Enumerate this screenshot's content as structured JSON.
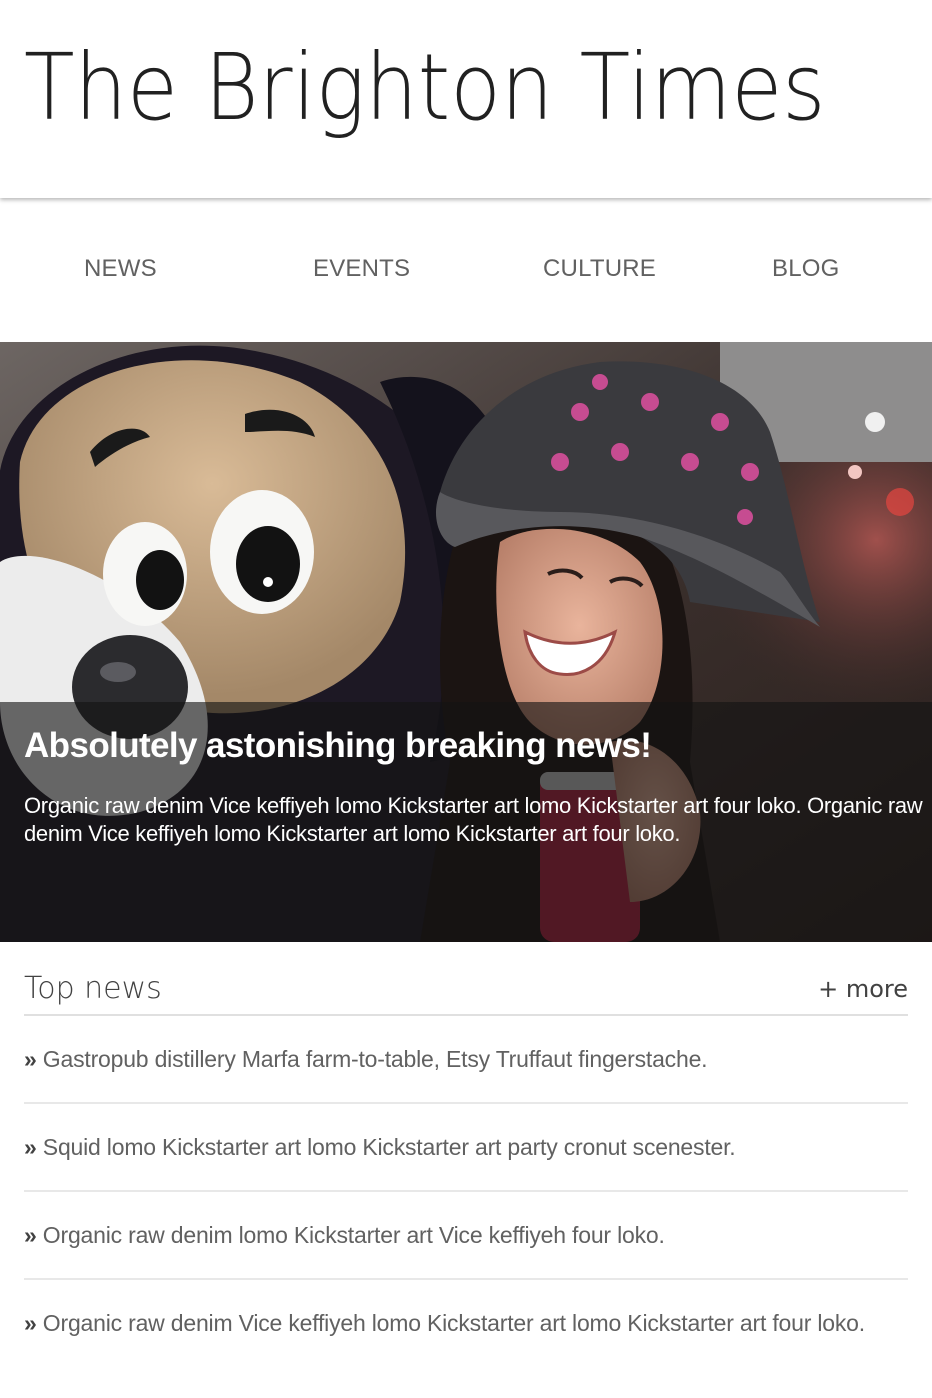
{
  "site": {
    "title": "The Brighton Times"
  },
  "nav": {
    "items": [
      {
        "label": "NEWS"
      },
      {
        "label": "EVENTS"
      },
      {
        "label": "CULTURE"
      },
      {
        "label": "BLOG"
      }
    ]
  },
  "hero": {
    "headline": "Absolutely astonishing breaking news!",
    "summary": "Organic raw denim Vice keffiyeh lomo Kickstarter art lomo Kickstarter art four loko. Organic raw denim Vice keffiyeh lomo Kickstarter art lomo Kickstarter art four loko."
  },
  "top_news": {
    "title": "Top news",
    "more_label": "+ more",
    "bullet": "»",
    "items": [
      {
        "text": "Gastropub distillery Marfa farm-to-table, Etsy Truffaut fingerstache."
      },
      {
        "text": "Squid lomo Kickstarter art lomo Kickstarter art party cronut scenester."
      },
      {
        "text": "Organic raw denim lomo Kickstarter art Vice keffiyeh four loko."
      },
      {
        "text": "Organic raw denim Vice keffiyeh lomo Kickstarter art lomo Kickstarter art four loko."
      }
    ]
  },
  "colors": {
    "title_text": "#212121",
    "nav_text": "#616161",
    "caption_overlay": "rgba(20,20,20,0.62)",
    "divider": "#e0e0e0",
    "news_text": "#616161"
  }
}
